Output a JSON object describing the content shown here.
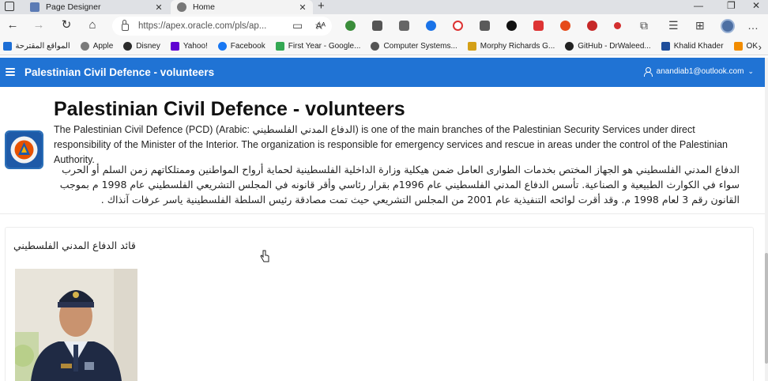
{
  "browser": {
    "tabs": [
      {
        "label": "Page Designer",
        "active": false
      },
      {
        "label": "Home",
        "active": true
      }
    ],
    "new_tab_glyph": "+",
    "address": "https://apex.oracle.com/pls/ap...",
    "reader_mode": "Aᴬ",
    "more_glyph": "…",
    "bookmarks": [
      {
        "label": "المواقع المقترحة",
        "color": "#1d6fd6"
      },
      {
        "label": "Apple",
        "color": "#7a7a7a"
      },
      {
        "label": "Disney",
        "color": "#2b2b2b"
      },
      {
        "label": "Yahoo!",
        "color": "#6001d2"
      },
      {
        "label": "Facebook",
        "color": "#1877f2"
      },
      {
        "label": "First Year - Google...",
        "color": "#34a853"
      },
      {
        "label": "Computer Systems...",
        "color": "#555555"
      },
      {
        "label": "Morphy Richards G...",
        "color": "#d4a017"
      },
      {
        "label": "GitHub - DrWaleed...",
        "color": "#222222"
      },
      {
        "label": "Khalid Khader",
        "color": "#1f4e9b"
      },
      {
        "label": "OK",
        "color": "#f28c00"
      }
    ]
  },
  "app": {
    "header_title": "Palestinian Civil Defence - volunteers",
    "user_email": "anandiab1@outlook.com",
    "accent_color": "#2073d4"
  },
  "page": {
    "title": "Palestinian Civil Defence - volunteers",
    "description_en": "The Palestinian Civil Defence (PCD) (Arabic: الدفاع المدني الفلسطيني) is one of the main branches of the Palestinian Security Services under direct responsibility of the Minister of the Interior. The organization is responsible for emergency services and rescue in areas under the control of the Palestinian Authority.",
    "description_ar": "الدفاع المدني الفلسطيني هو الجهاز المختص بخدمات الطوارى العامل ضمن هيكلية وزارة الداخلية الفلسطينية لحماية أرواح المواطنين وممتلكاتهم زمن السلم أو الحرب سواء في الكوارث الطبيعية و الصناعية. تأسس الدفاع المدني الفلسطيني عام 1996م بقرار رئاسي وأقر قانونه في المجلس التشريعي الفلسطيني عام 1998 م بموجب القانون رقم 3 لعام 1998 م. وقد أقرت لوائحه التنفيذية عام 2001 من المجلس التشريعي حيث تمت مصادقة رئيس السلطة الفلسطينية ياسر عرفات آنذاك .",
    "region_title": "قائد الدفاع المدني الفلسطيني"
  },
  "icons": [
    "window-icon",
    "back-icon",
    "forward-icon",
    "refresh-icon",
    "home-icon",
    "lock-icon",
    "menu-icon",
    "user-icon",
    "chevron-down-icon",
    "pcd-logo-icon",
    "hand-cursor-icon"
  ]
}
